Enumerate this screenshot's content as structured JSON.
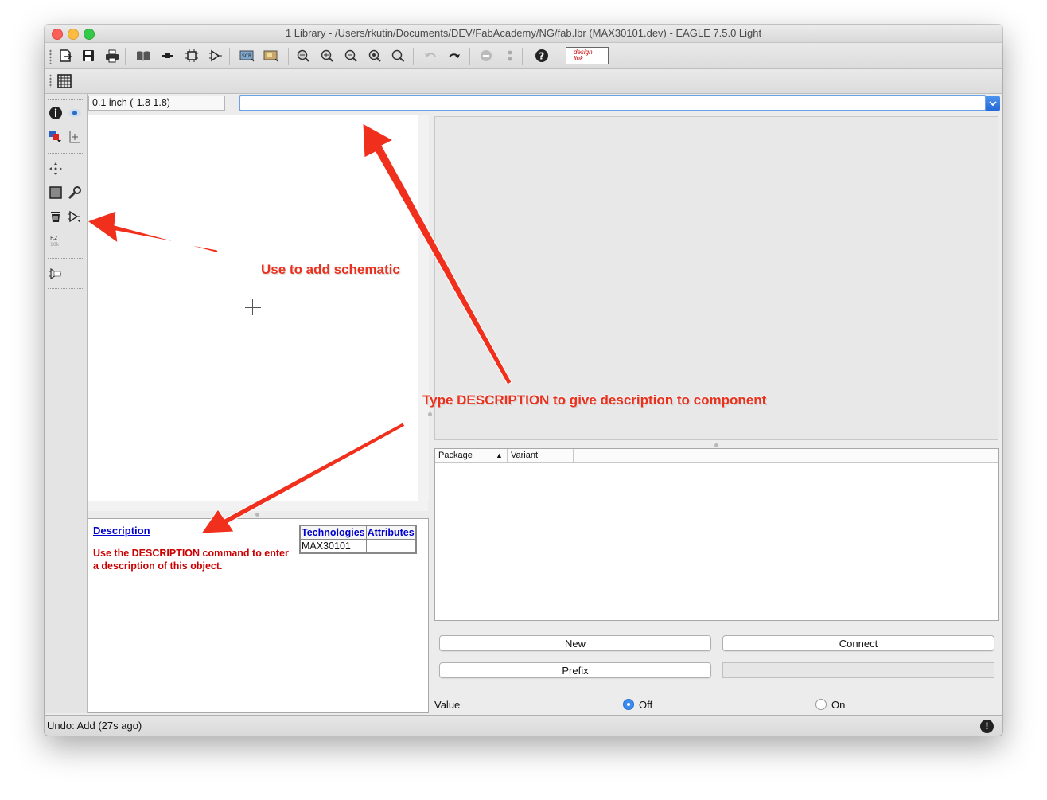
{
  "window": {
    "title": "1 Library - /Users/rkutin/Documents/DEV/FabAcademy/NG/fab.lbr (MAX30101.dev) - EAGLE 7.5.0 Light"
  },
  "toolbar": {
    "icons": [
      "open-icon",
      "save-icon",
      "print-icon",
      "library-icon",
      "package-icon",
      "symbol-icon",
      "device-icon",
      "script-icon",
      "run-ulp-icon",
      "zoom-fit-icon",
      "zoom-in-icon",
      "zoom-out-icon",
      "zoom-redraw-icon",
      "zoom-select-icon",
      "undo-icon",
      "redo-icon",
      "stop-icon",
      "go-icon",
      "help-icon",
      "designlink-icon"
    ],
    "designlink_text": "design link"
  },
  "coordinates": {
    "value": "0.1 inch (-1.8 1.8)"
  },
  "command": {
    "value": "",
    "placeholder": ""
  },
  "description_panel": {
    "link": "Description",
    "text": "Use the DESCRIPTION command to enter a description of this object.",
    "table": {
      "headers": [
        "Technologies",
        "Attributes"
      ],
      "rows": [
        [
          "MAX30101",
          ""
        ]
      ]
    }
  },
  "package_table": {
    "headers": [
      "Package",
      "Variant"
    ],
    "sort_indicator": "▲"
  },
  "buttons": {
    "new": "New",
    "connect": "Connect",
    "prefix": "Prefix"
  },
  "value": {
    "label": "Value",
    "options": [
      {
        "label": "Off",
        "selected": true
      },
      {
        "label": "On",
        "selected": false
      }
    ]
  },
  "status": {
    "text": "Undo: Add (27s ago)",
    "icon": "!"
  },
  "annotations": {
    "add_schematic": "Use to add schematic",
    "type_description": "Type DESCRIPTION to give description to component"
  },
  "colors": {
    "annotation": "#e8321f",
    "link": "#0000cc",
    "desc_text": "#cc0000",
    "accent": "#3b8bf0"
  }
}
